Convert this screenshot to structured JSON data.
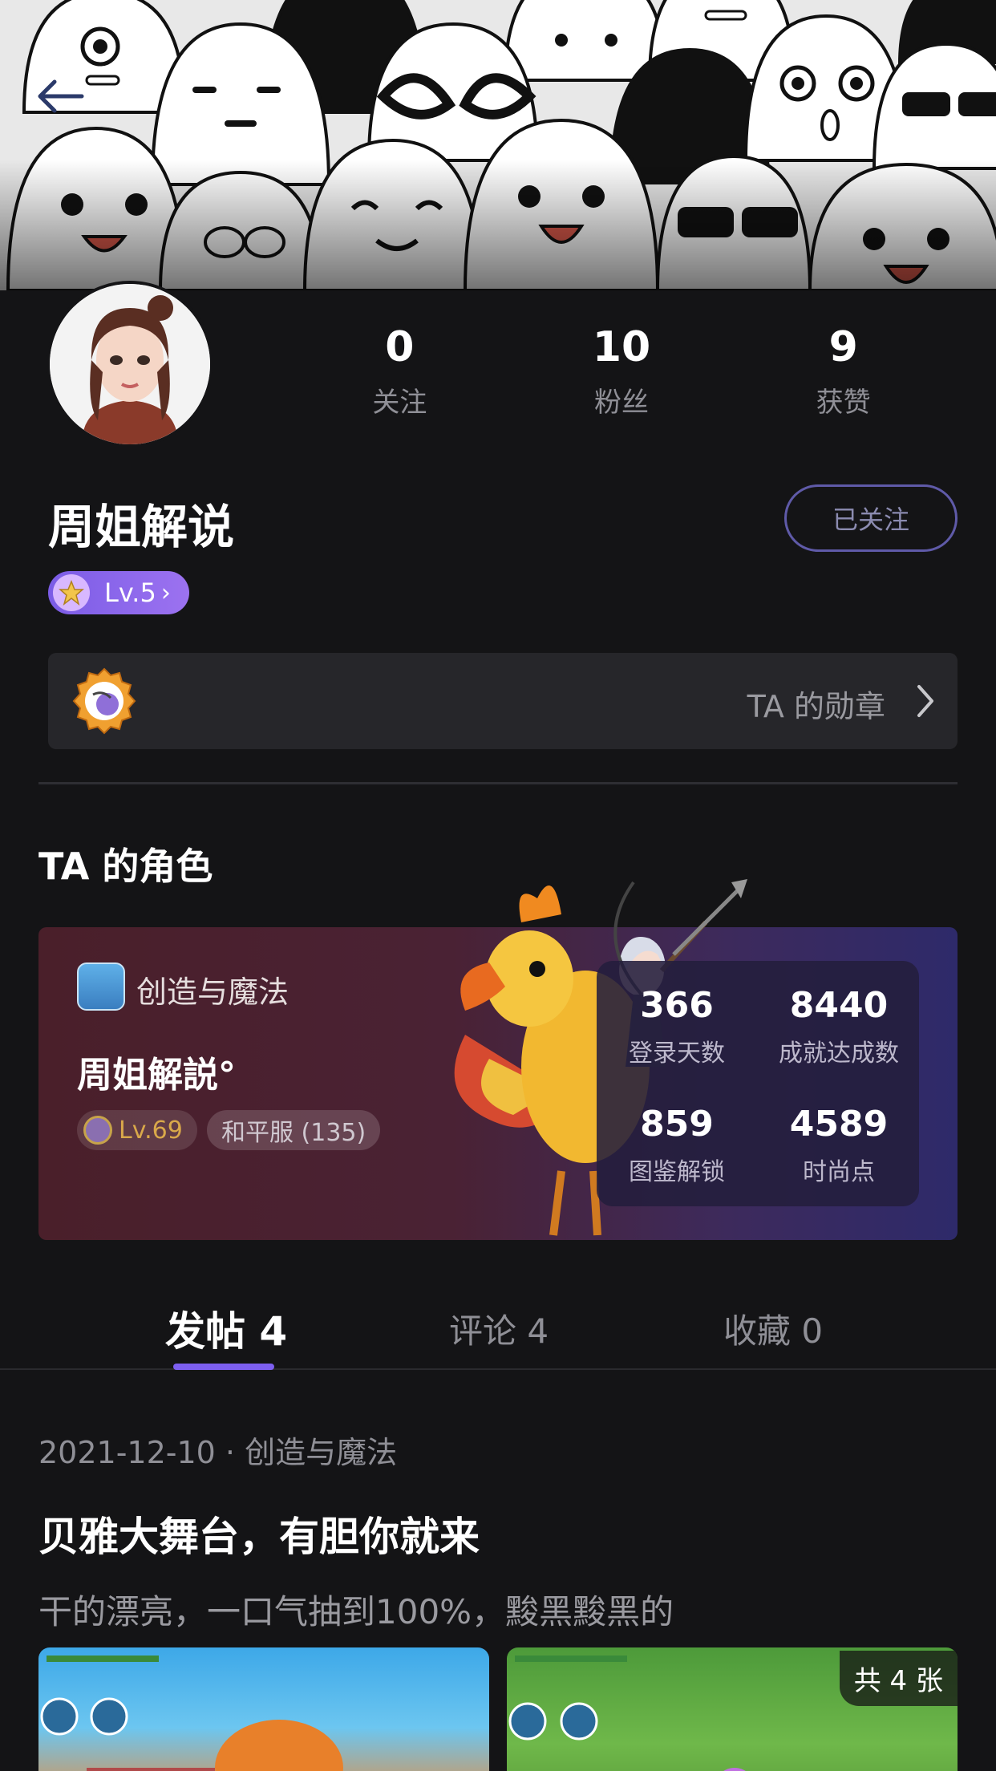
{
  "nav": {
    "back_icon": "arrow-left-icon"
  },
  "profile": {
    "username": "周姐解说",
    "level": "Lv.5",
    "follow_button": "已关注",
    "stats": [
      {
        "value": "0",
        "label": "关注"
      },
      {
        "value": "10",
        "label": "粉丝"
      },
      {
        "value": "9",
        "label": "获赞"
      }
    ],
    "medal_label": "TA 的勋章"
  },
  "role_section": {
    "title": "TA 的角色",
    "game_name": "创造与魔法",
    "character_name": "周姐解説°",
    "character_level": "Lv.69",
    "server": "和平服 (135)",
    "stats": [
      {
        "value": "366",
        "label": "登录天数"
      },
      {
        "value": "8440",
        "label": "成就达成数"
      },
      {
        "value": "859",
        "label": "图鉴解锁"
      },
      {
        "value": "4589",
        "label": "时尚点"
      }
    ]
  },
  "tabs": [
    {
      "label": "发帖 4",
      "active": true
    },
    {
      "label": "评论 4",
      "active": false
    },
    {
      "label": "收藏 0",
      "active": false
    }
  ],
  "post": {
    "meta": "2021-12-10 · 创造与魔法",
    "title": "贝雅大舞台，有胆你就来",
    "body": "干的漂亮，一口气抽到100%，黢黑黢黑的",
    "image_count": "共 4 张"
  },
  "colors": {
    "accent": "#7d5ff0",
    "background": "#141416"
  }
}
